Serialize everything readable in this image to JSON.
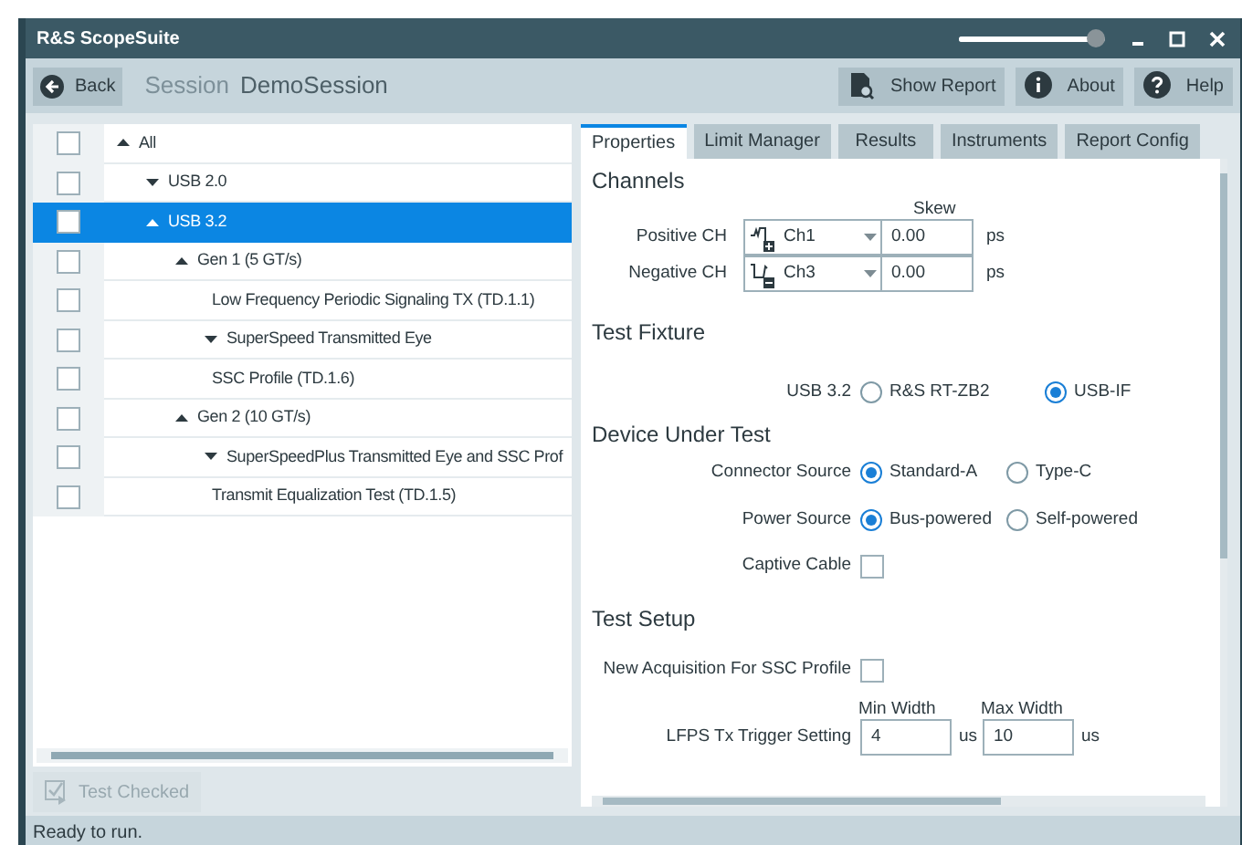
{
  "window": {
    "title": "R&S ScopeSuite",
    "zoom_slider": {
      "level": 0.95
    }
  },
  "toolbar": {
    "back": "Back",
    "session_label": "Session",
    "session_name": "DemoSession",
    "buttons": [
      {
        "label": "Show Report",
        "kind": "report"
      },
      {
        "label": "About",
        "kind": "info"
      },
      {
        "label": "Help",
        "kind": "help"
      }
    ]
  },
  "tree": [
    {
      "label": "All",
      "checked": false,
      "selected": false,
      "expanded": true,
      "children": [
        {
          "label": "USB 2.0",
          "checked": false,
          "selected": false,
          "expanded": false
        },
        {
          "label": "USB 3.2",
          "checked": false,
          "selected": true,
          "expanded": true,
          "children": [
            {
              "label": "Gen 1 (5 GT/s)",
              "checked": false,
              "selected": false,
              "expanded": true,
              "children": [
                {
                  "label": "Low Frequency Periodic Signaling TX (TD.1.1)",
                  "checked": false,
                  "selected": false
                },
                {
                  "label": "SuperSpeed Transmitted Eye",
                  "checked": false,
                  "selected": false,
                  "expanded": false
                },
                {
                  "label": "SSC Profile (TD.1.6)",
                  "checked": false,
                  "selected": false
                }
              ]
            },
            {
              "label": "Gen 2 (10 GT/s)",
              "checked": false,
              "selected": false,
              "expanded": true,
              "children": [
                {
                  "label": "SuperSpeedPlus Transmitted Eye and SSC Prof",
                  "checked": false,
                  "selected": false,
                  "expanded": false
                },
                {
                  "label": "Transmit Equalization Test (TD.1.5)",
                  "checked": false,
                  "selected": false
                }
              ]
            }
          ]
        }
      ]
    }
  ],
  "run_button": {
    "label": "Test Checked",
    "disabled": true
  },
  "tabs": [
    {
      "label": "Properties",
      "selected": true
    },
    {
      "label": "Limit Manager",
      "selected": false
    },
    {
      "label": "Results",
      "selected": false
    },
    {
      "label": "Instruments",
      "selected": false
    },
    {
      "label": "Report Config",
      "selected": false
    }
  ],
  "sections": [
    {
      "title": "Channels",
      "fields": [
        {
          "kind": "channels",
          "column": "Skew",
          "rows": [
            {
              "label": "Positive CH",
              "kind": "positive",
              "channel": "Ch1",
              "skew": "0.00",
              "unit": "ps"
            },
            {
              "label": "Negative CH",
              "kind": "negative",
              "channel": "Ch3",
              "skew": "0.00",
              "unit": "ps"
            }
          ]
        }
      ]
    },
    {
      "title": "Test Fixture",
      "fields": [
        {
          "kind": "radio",
          "label": "USB 3.2",
          "options": [
            {
              "label": "R&S RT-ZB2",
              "selected": false
            },
            {
              "label": "USB-IF",
              "selected": true
            }
          ]
        }
      ]
    },
    {
      "title": "Device Under Test",
      "fields": [
        {
          "kind": "radio",
          "label": "Connector Source",
          "options": [
            {
              "label": "Standard-A",
              "selected": true
            },
            {
              "label": "Type-C",
              "selected": false
            }
          ]
        },
        {
          "kind": "radio",
          "label": "Power Source",
          "options": [
            {
              "label": "Bus-powered",
              "selected": true
            },
            {
              "label": "Self-powered",
              "selected": false
            }
          ]
        },
        {
          "kind": "checkbox",
          "label": "Captive Cable",
          "checked": false
        }
      ]
    },
    {
      "title": "Test Setup",
      "fields": [
        {
          "kind": "checkbox",
          "label": "New Acquisition For SSC Profile",
          "checked": false
        },
        {
          "kind": "range",
          "label": "LFPS Tx Trigger Setting",
          "inputs": [
            {
              "caption": "Min Width",
              "value": "4",
              "unit": "us"
            },
            {
              "caption": "Max Width",
              "value": "10",
              "unit": "us"
            }
          ]
        }
      ]
    }
  ],
  "status_bar": "Ready to run."
}
